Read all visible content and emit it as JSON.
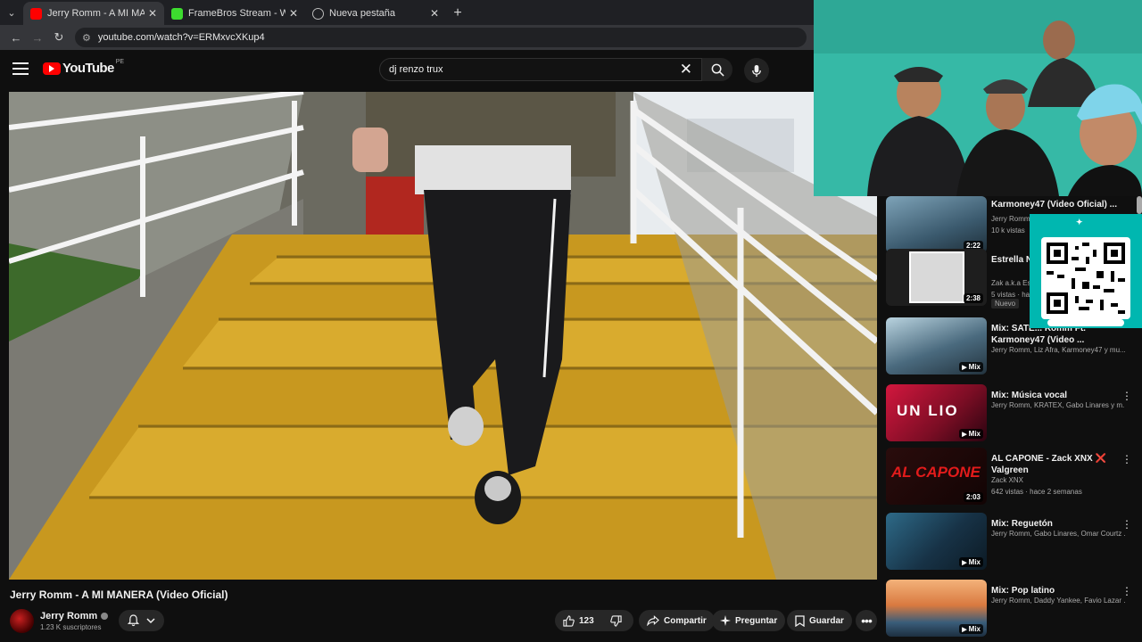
{
  "browser": {
    "tabs": [
      {
        "title": "Jerry Romm - A MI MANERA (V",
        "favicon_color": "#ff0000",
        "active": true
      },
      {
        "title": "FrameBros Stream - Watch Live",
        "favicon_color": "#3ddc2f",
        "active": false
      },
      {
        "title": "Nueva pestaña",
        "favicon_color": "#9aa0a6",
        "active": false
      }
    ],
    "url": "youtube.com/watch?v=ERMxvcXKup4",
    "tab_menu_icon": "chevron-down-icon",
    "new_tab_icon": "plus-icon"
  },
  "header": {
    "logo_text": "YouTube",
    "country_code": "PE",
    "search_query": "dj renzo trux"
  },
  "video": {
    "title": "Jerry Romm - A MI MANERA (Video Oficial)",
    "channel": "Jerry Romm",
    "subscribers": "1.23 K suscriptores",
    "likes": "123",
    "share_label": "Compartir",
    "ask_label": "Preguntar",
    "save_label": "Guardar"
  },
  "recommendations": [
    {
      "title": "Karmoney47 (Video Oficial) ...",
      "meta1": "Jerry Romm",
      "meta2": "10 k vistas",
      "badge": "2:22",
      "thumb_color": "#3b5a6e",
      "new": false
    },
    {
      "title": "Estrella Ne... hoy (prod.",
      "meta1": "Zak a.k.a Es",
      "meta2": "5 vistas · ha",
      "badge": "2:38",
      "thumb_color": "#2b2b2b",
      "new": true,
      "new_label": "Nuevo"
    },
    {
      "title": "Mix: SATE... Romm Ft. Karmoney47 (Video ...",
      "meta1": "Jerry Romm, Liz Afra, Karmoney47 y mu...",
      "meta2": "",
      "badge": "Mix",
      "thumb_color": "#4a6a7e",
      "new": false
    },
    {
      "title": "Mix: Música vocal",
      "meta1": "Jerry Romm, KRATEX, Gabo Linares y m...",
      "meta2": "",
      "badge": "Mix",
      "thumb_color": "#a01030",
      "new": false
    },
    {
      "title": "AL CAPONE - Zack XNX ❌ Valgreen",
      "meta1": "Zack XNX",
      "meta2": "642 vistas · hace 2 semanas",
      "badge": "2:03",
      "thumb_color": "#1a0808",
      "new": false
    },
    {
      "title": "Mix: Reguetón",
      "meta1": "Jerry Romm, Gabo Linares, Omar Courtz ...",
      "meta2": "",
      "badge": "Mix",
      "thumb_color": "#1d3d55",
      "new": false
    },
    {
      "title": "Mix: Pop latino",
      "meta1": "Jerry Romm, Daddy Yankee, Favio Lazar ...",
      "meta2": "",
      "badge": "Mix",
      "thumb_color": "#d97a40",
      "new": false
    }
  ]
}
